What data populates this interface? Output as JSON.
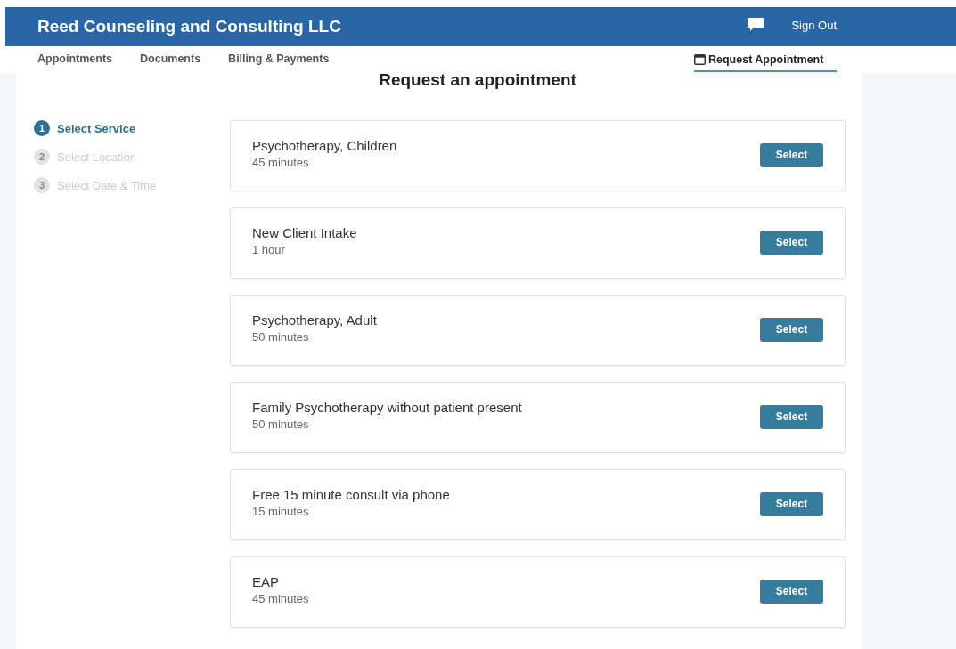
{
  "header": {
    "title": "Reed Counseling and Consulting LLC",
    "sign_out": "Sign Out"
  },
  "nav": {
    "items": [
      {
        "label": "Appointments",
        "selected": false
      },
      {
        "label": "Documents",
        "selected": false
      },
      {
        "label": "Billing & Payments",
        "selected": false
      },
      {
        "label": "Request Appointment",
        "selected": true
      }
    ]
  },
  "page_title": "Request an appointment",
  "steps": [
    {
      "number": "1",
      "label": "Select Service",
      "selected": true
    },
    {
      "number": "2",
      "label": "Select Location",
      "selected": false
    },
    {
      "number": "3",
      "label": "Select Date & Time",
      "selected": false
    }
  ],
  "services": [
    {
      "name": "Psychotherapy, Children",
      "duration": "45 minutes",
      "button": "Select"
    },
    {
      "name": "New Client Intake",
      "duration": "1 hour",
      "button": "Select"
    },
    {
      "name": "Psychotherapy, Adult",
      "duration": "50 minutes",
      "button": "Select"
    },
    {
      "name": "Family Psychotherapy without patient present",
      "duration": "50 minutes",
      "button": "Select"
    },
    {
      "name": "Free 15 minute consult via phone",
      "duration": "15 minutes",
      "button": "Select"
    },
    {
      "name": "EAP",
      "duration": "45 minutes",
      "button": "Select"
    }
  ]
}
